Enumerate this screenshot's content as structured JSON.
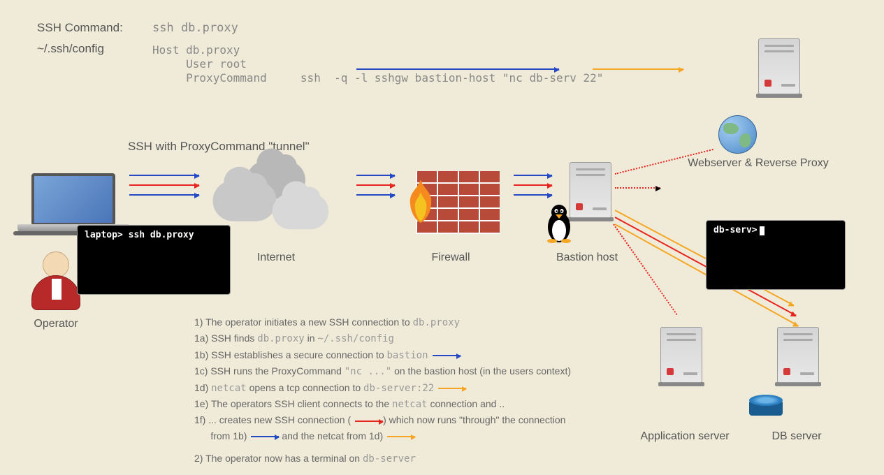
{
  "header": {
    "ssh_cmd_lbl": "SSH Command:",
    "ssh_cmd": "ssh db.proxy",
    "cfg_lbl": "~/.ssh/config",
    "cfg_line1": "Host db.proxy",
    "cfg_line2": "     User root",
    "cfg_line3": "     ProxyCommand     ssh  -q -l sshgw bastion-host \"nc db-serv 22\""
  },
  "section_title": "SSH with ProxyCommand \"tunnel\"",
  "labels": {
    "operator": "Operator",
    "internet": "Internet",
    "firewall": "Firewall",
    "bastion": "Bastion host",
    "webproxy": "Webserver & Reverse Proxy",
    "appserver": "Application server",
    "dbserver": "DB server"
  },
  "term1": "laptop> ssh db.proxy",
  "term2": "db-serv>",
  "steps": {
    "s1a": "1) The operator initiates a new SSH connection to ",
    "s1b": "db.proxy",
    "s2a": "1a) SSH finds ",
    "s2b": "db.proxy",
    "s2c": " in ",
    "s2d": "~/.ssh/config",
    "s3a": "1b) SSH establishes a secure connection to ",
    "s3b": "bastion",
    "s4a": "1c) SSH runs the ProxyCommand ",
    "s4b": "\"nc ...\"",
    "s4c": "  on the bastion host (in the users context)",
    "s5a": "1d) ",
    "s5b": "netcat",
    "s5c": " opens a tcp connection to ",
    "s5d": "db-server:22",
    "s6a": "1e) The operators SSH client connects to the ",
    "s6b": "netcat",
    "s6c": " connection and ..",
    "s7a": "1f) ... creates new SSH connection (",
    "s7b": ") which now runs \"through\" the connection",
    "s8a": "      from 1b)",
    "s8b": " and the netcat from 1d)",
    "s9a": "2) The operator now has a terminal on ",
    "s9b": "db-server"
  }
}
